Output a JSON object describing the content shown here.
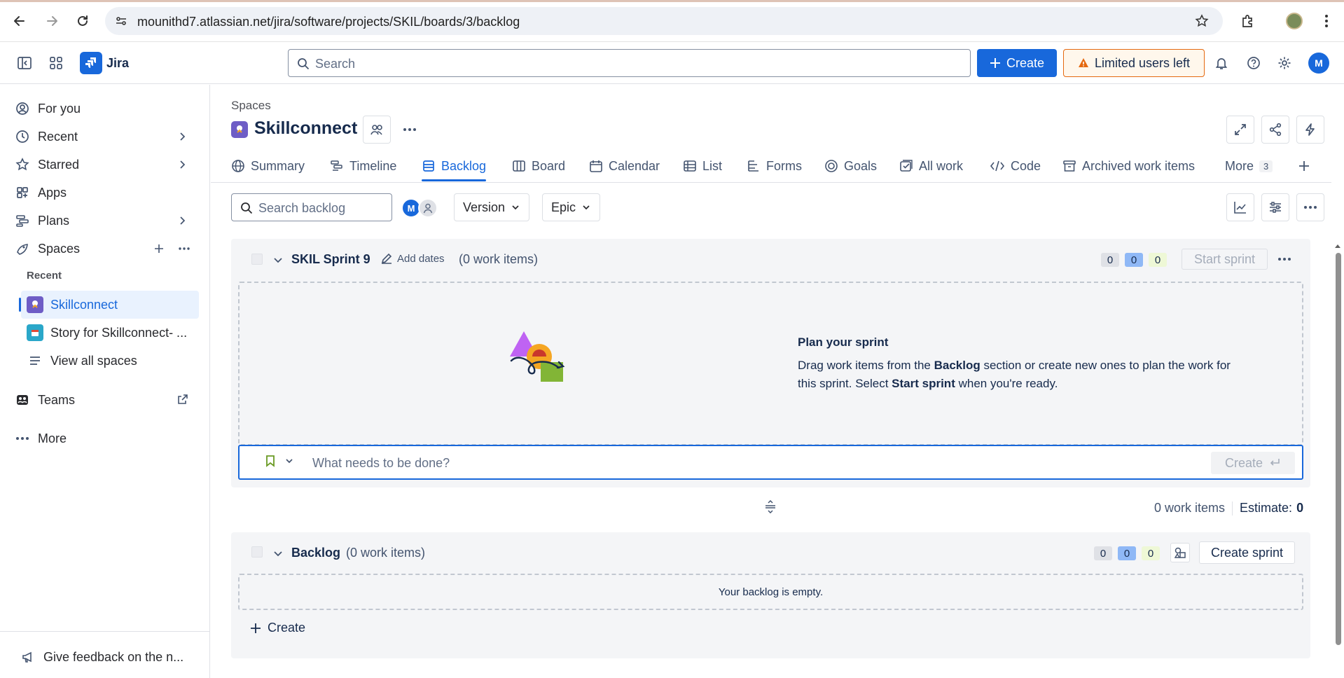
{
  "browser": {
    "url": "mounithd7.atlassian.net/jira/software/projects/SKIL/boards/3/backlog"
  },
  "topnav": {
    "app_name": "Jira",
    "search_placeholder": "Search",
    "create_label": "Create",
    "limited_users_label": "Limited users left",
    "avatar_initial": "M"
  },
  "sidebar": {
    "items": {
      "for_you": "For you",
      "recent": "Recent",
      "starred": "Starred",
      "apps": "Apps",
      "plans": "Plans",
      "spaces": "Spaces"
    },
    "recent_label": "Recent",
    "recent_spaces": {
      "skillconnect": "Skillconnect",
      "story": "Story for Skillconnect- ..."
    },
    "view_all": "View all spaces",
    "teams": "Teams",
    "more": "More",
    "feedback": "Give feedback on the n..."
  },
  "main": {
    "breadcrumb": "Spaces",
    "project_title": "Skillconnect",
    "tabs": {
      "summary": "Summary",
      "timeline": "Timeline",
      "backlog": "Backlog",
      "board": "Board",
      "calendar": "Calendar",
      "list": "List",
      "forms": "Forms",
      "goals": "Goals",
      "all_work": "All work",
      "code": "Code",
      "archived": "Archived work items",
      "more": "More",
      "more_count": "3"
    },
    "filters": {
      "search_placeholder": "Search backlog",
      "avatar_initial": "M",
      "version": "Version",
      "epic": "Epic"
    },
    "sprint": {
      "name": "SKIL Sprint 9",
      "add_dates": "Add dates",
      "count": "(0 work items)",
      "badge_todo": "0",
      "badge_progress": "0",
      "badge_done": "0",
      "start_label": "Start sprint",
      "plan_title": "Plan your sprint",
      "plan_text_1": "Drag work items from the ",
      "plan_text_bold_1": "Backlog",
      "plan_text_2": " section or create new ones to plan the work for this sprint. Select ",
      "plan_text_bold_2": "Start sprint",
      "plan_text_3": " when you're ready.",
      "input_placeholder": "What needs to be done?",
      "inline_create": "Create"
    },
    "summary": {
      "work_items": "0 work items",
      "estimate_label": "Estimate:",
      "estimate_value": "0"
    },
    "backlog": {
      "title": "Backlog",
      "count": "(0 work items)",
      "badge_todo": "0",
      "badge_progress": "0",
      "badge_done": "0",
      "create_sprint": "Create sprint",
      "empty_text": "Your backlog is empty.",
      "create_label": "Create"
    }
  },
  "colors": {
    "brand_blue": "#1868db",
    "warning_orange": "#e56910",
    "project_purple": "#6e5dc6"
  }
}
